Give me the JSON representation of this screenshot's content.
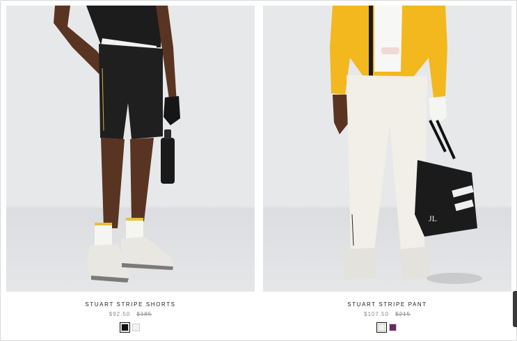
{
  "products": [
    {
      "name": "STUART STRIPE SHORTS",
      "sale_price": "$92.50",
      "original_price": "$185",
      "swatches": [
        {
          "color": "#111111",
          "selected": true
        },
        {
          "color": "#f2f2f2",
          "selected": false
        }
      ]
    },
    {
      "name": "STUART STRIPE PANT",
      "sale_price": "$107.50",
      "original_price": "$215",
      "swatches": [
        {
          "color": "#f0efea",
          "selected": true
        },
        {
          "color": "#6a2a5e",
          "selected": false
        }
      ]
    }
  ]
}
